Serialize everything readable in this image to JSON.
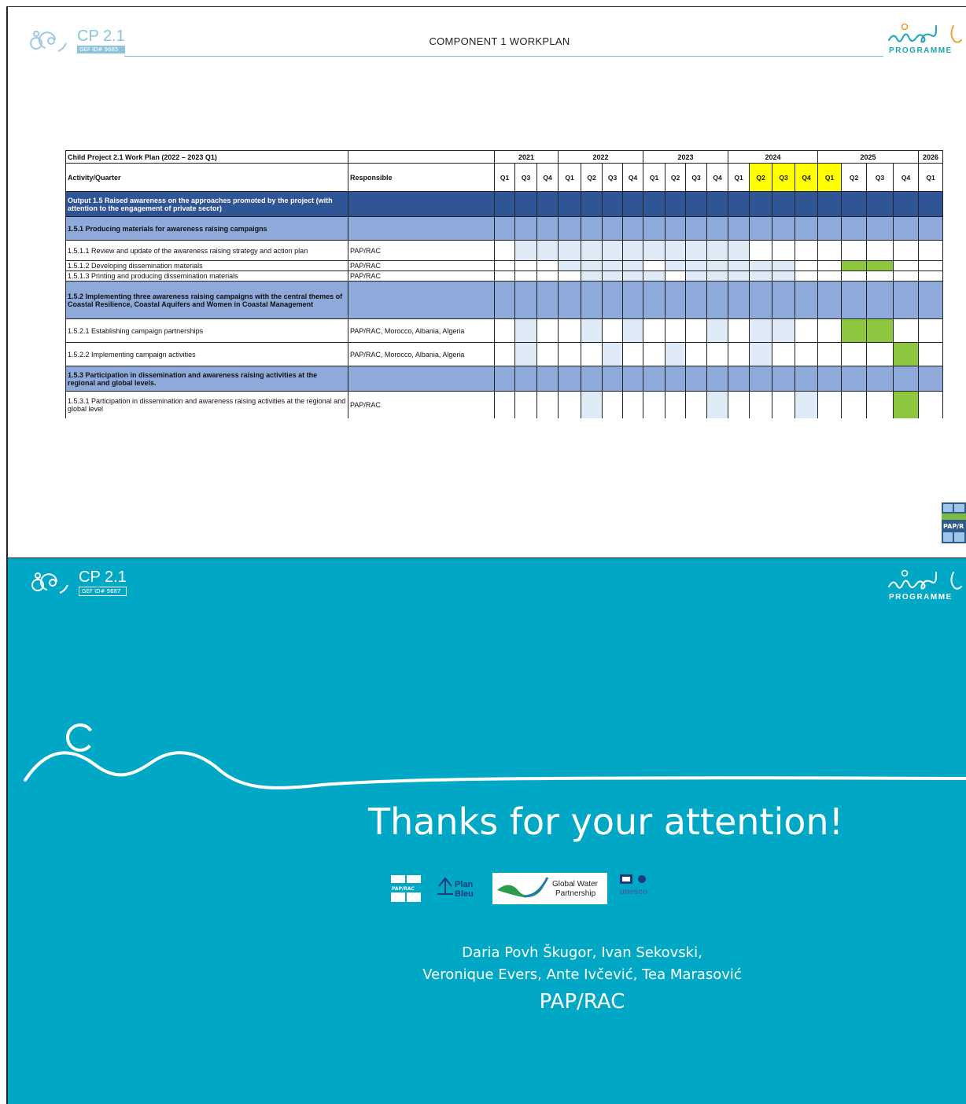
{
  "slide1": {
    "logo": {
      "title": "CP 2.1",
      "badge": "GEF ID# 9685"
    },
    "header_title": "COMPONENT 1 WORKPLAN",
    "med_logo": {
      "word": "PROGRAMME"
    },
    "corner_logo": {
      "text": "PAP/R"
    },
    "workplan": {
      "caption": "Child Project 2.1 Work Plan (2022 – 2023 Q1)",
      "activity_header": "Activity/Quarter",
      "responsible_header": "Responsible",
      "years": [
        "2021",
        "2022",
        "2023",
        "2024",
        "2025",
        "2026"
      ],
      "quarters": [
        "Q1",
        "Q3",
        "Q4",
        "Q1",
        "Q2",
        "Q3",
        "Q4",
        "Q1",
        "Q2",
        "Q3",
        "Q4",
        "Q1",
        "Q2",
        "Q3",
        "Q4",
        "Q1",
        "Q2",
        "Q3",
        "Q4",
        "Q1"
      ],
      "highlighted_quarter_indices": [
        12,
        13,
        14,
        15
      ],
      "rows": [
        {
          "type": "output",
          "label": "Output 1.5 Raised awareness on the approaches promoted by the project (with attention to the engagement of private sector)",
          "responsible": "",
          "cells": ""
        },
        {
          "type": "section",
          "label": "1.5.1 Producing materials for awareness raising campaigns",
          "responsible": "",
          "cells": ""
        },
        {
          "type": "activity",
          "label": "1.5.1.1 Review and update of the awareness raising strategy and action plan",
          "responsible": "PAP/RAC",
          "cells": ".LLLLLLLLLLL........"
        },
        {
          "type": "activity",
          "label": "1.5.1.2 Developing dissemination materials",
          "responsible": "PAP/RAC",
          "cells": "...LLLL.LLLLLL..GG.."
        },
        {
          "type": "activity",
          "label": "1.5.1.3 Printing and producing dissemination materials",
          "responsible": "PAP/RAC",
          "cells": "....LLLL.LLLLL......"
        },
        {
          "type": "section",
          "label": "1.5.2 Implementing three awareness raising campaigns with the central themes of Coastal Resilience, Coastal Aquifers and Women in Coastal Management",
          "responsible": "",
          "cells": ""
        },
        {
          "type": "activity",
          "label": "1.5.2.1 Establishing campaign partnerships",
          "responsible": "PAP/RAC, Morocco, Albania, Algeria",
          "cells": ".L..L.L...L.LL..GG.."
        },
        {
          "type": "activity",
          "label": "1.5.2.2  Implementing campaign activities",
          "responsible": "PAP/RAC, Morocco, Albania, Algeria",
          "cells": ".L...L..L...L.....G."
        },
        {
          "type": "section",
          "label": "1.5.3 Participation in dissemination and awareness raising activities at the regional and global levels.",
          "responsible": "",
          "cells": ""
        },
        {
          "type": "activity",
          "label": "1.5.3.1 Participation in dissemination and awareness raising activities at the regional and global level",
          "responsible": "PAP/RAC",
          "cells": "....L.....L...L...G."
        }
      ]
    }
  },
  "slide2": {
    "logo": {
      "title": "CP 2.1",
      "badge": "GEF ID# 9687"
    },
    "med_logo": {
      "word": "PROGRAMME"
    },
    "thanks": "Thanks for your attention!",
    "partner_logos": {
      "paprac": "PAP/RAC",
      "planbleu_1": "Plan",
      "planbleu_2": "Bleu",
      "gwp_1": "Global Water",
      "gwp_2": "Partnership",
      "unesco": "unesco"
    },
    "authors_line1": "Daria Povh Škugor, Ivan Sekovski,",
    "authors_line2": "Veronique Evers, Ante Ivčević, Tea Marasović",
    "organization": "PAP/RAC"
  },
  "colors": {
    "teal": "#01a8c6",
    "output_row": "#2f5597",
    "section_row": "#8eaadb",
    "light_cell": "#deebf7",
    "green_cell": "#8dc63f",
    "highlight_quarter": "#ffff00",
    "med_orange": "#f0a030",
    "med_teal": "#1aa6b7"
  }
}
